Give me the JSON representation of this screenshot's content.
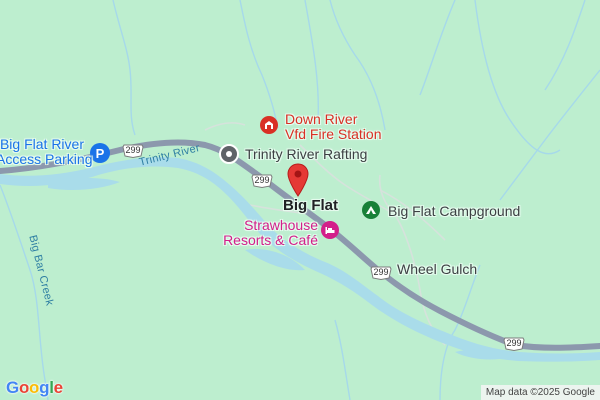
{
  "map": {
    "colors": {
      "land": "#bdeecf",
      "water": "#a9dcea",
      "highway": "#8c98ad",
      "minor_road": "#d6e2dc",
      "stream": "#a6d9ea",
      "pin": "#e53935"
    },
    "town": {
      "label": "Big Flat"
    },
    "highway": {
      "shield_number": "299"
    },
    "river": {
      "label": "Trinity River"
    },
    "creek": {
      "label": "Big Bar Creek"
    },
    "places": [
      {
        "key": "fire_station",
        "label": "Down River\nVfd Fire Station",
        "icon": "fire-station-icon",
        "color": "#d93025"
      },
      {
        "key": "rafting",
        "label": "Trinity River Rafting",
        "icon": "location-icon",
        "color": "#5f6368"
      },
      {
        "key": "campground",
        "label": "Big Flat Campground",
        "icon": "tent-icon",
        "color": "#188038"
      },
      {
        "key": "strawhouse",
        "label": "Strawhouse\nResorts & Café",
        "icon": "hotel-icon",
        "color": "#d31e8a"
      },
      {
        "key": "parking",
        "label": "Big Flat River\nAccess Parking",
        "icon": "parking-icon",
        "color": "#1a73e8"
      },
      {
        "key": "wheel_gulch",
        "label": "Wheel Gulch"
      }
    ],
    "logo": "Google",
    "attribution": "Map data ©2025 Google"
  }
}
